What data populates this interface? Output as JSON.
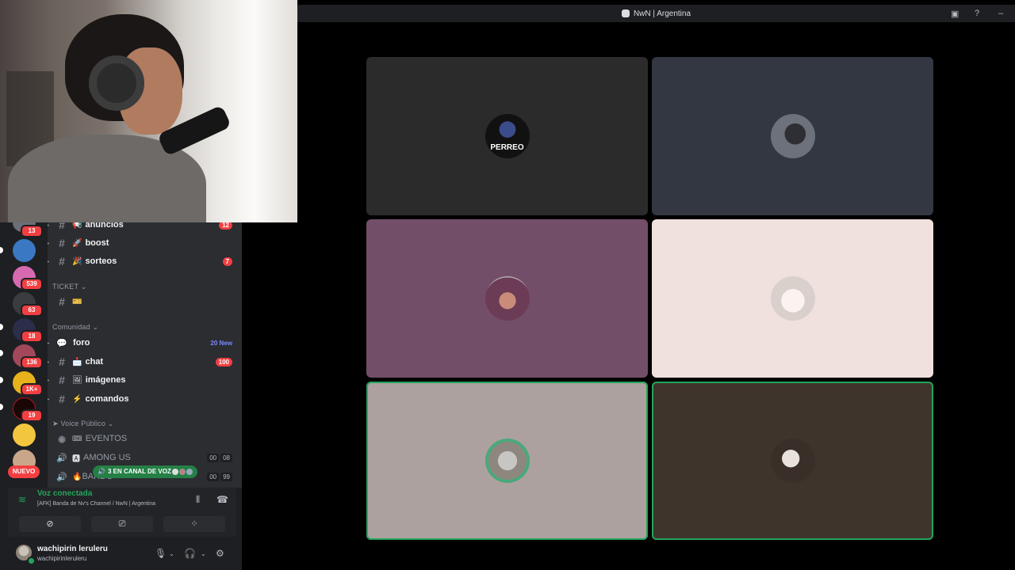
{
  "topbar": {
    "server_title": "NwN | Argentina",
    "icons": [
      "inbox-icon",
      "help-icon",
      "minimize-icon"
    ]
  },
  "servers": {
    "badges": [
      "13",
      "539",
      "63",
      "18",
      "136",
      "1K+",
      "19"
    ],
    "nuevo_label": "NUEVO"
  },
  "channels": {
    "top_channels": [
      {
        "emoji": "📢",
        "name": "anuncios",
        "badge": "12"
      },
      {
        "emoji": "🚀",
        "name": "boost",
        "badge": ""
      },
      {
        "emoji": "🎉",
        "name": "sorteos",
        "badge": "7"
      }
    ],
    "ticket_category": "TICKET",
    "ticket_channel_emoji": "🎫",
    "community_category": "Comunidad",
    "community_channels": [
      {
        "emoji": "💬",
        "name": "foro",
        "new": "20 New"
      },
      {
        "emoji": "📩",
        "name": "chat",
        "badge": "100"
      },
      {
        "emoji": "🖼",
        "name": "imágenes"
      },
      {
        "emoji": "⚡",
        "name": "comandos"
      }
    ],
    "voice_category": "Voice Público",
    "voice_channels": [
      {
        "name": "EVENTOS",
        "emoji": "🎟"
      },
      {
        "name": "AMONG US",
        "emoji": "🅰",
        "users": [
          "00",
          "08"
        ]
      },
      {
        "name": "BARDO",
        "emoji": "🔥",
        "users": [
          "00",
          "99"
        ]
      }
    ],
    "voice_pill": "3 EN CANAL DE VOZ"
  },
  "voice_panel": {
    "title": "Voz conectada",
    "subtitle": "[AFK] Banda de Nv's Channel / NwN | Argentina"
  },
  "user": {
    "name": "wachipirin leruleru",
    "handle": "wachipirinleruleru"
  },
  "tiles": [
    {
      "bg": "#2b2b2c",
      "avatar_text": "PERREO",
      "speaking": false
    },
    {
      "bg": "#323741",
      "avatar_text": "",
      "speaking": false
    },
    {
      "bg": "#734e68",
      "avatar_text": "",
      "speaking": false
    },
    {
      "bg": "#f0e0de",
      "avatar_text": "",
      "speaking": false
    },
    {
      "bg": "#ada1a0",
      "avatar_text": "",
      "speaking": true
    },
    {
      "bg": "#3f342c",
      "avatar_text": "",
      "speaking": true
    }
  ],
  "colors": {
    "accent_green": "#23a55a",
    "danger_red": "#f23f42",
    "sidebar": "#2b2d31"
  }
}
